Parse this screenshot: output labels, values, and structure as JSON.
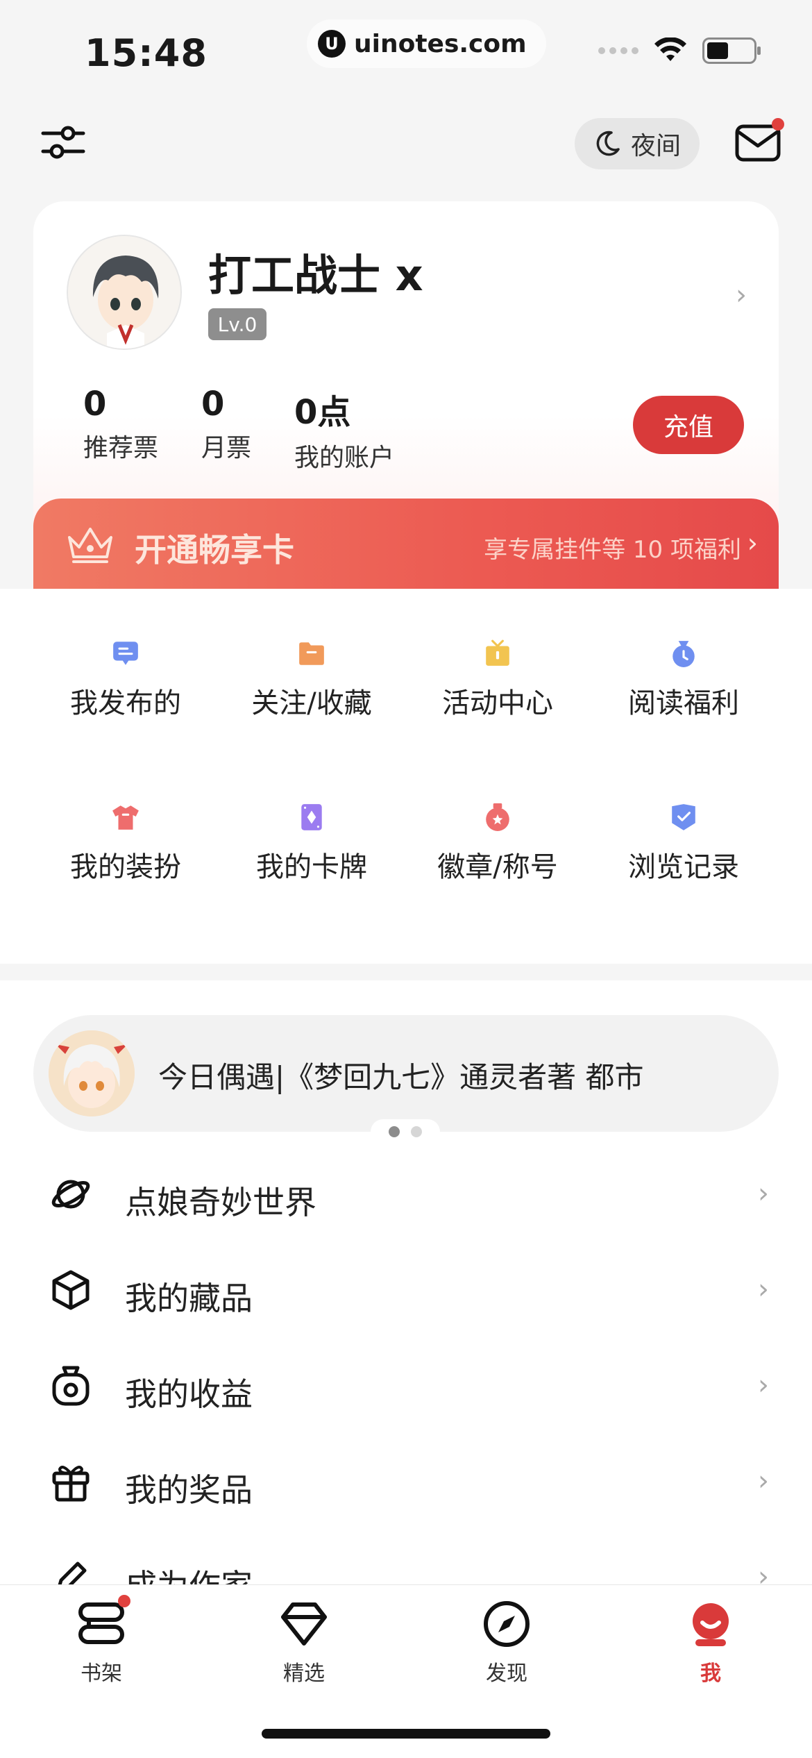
{
  "status_bar": {
    "time": "15:48",
    "url": "uinotes.com"
  },
  "header": {
    "night_label": "夜间"
  },
  "profile": {
    "username": "打工战士 x",
    "level": "Lv.0",
    "stats": [
      {
        "value": "0",
        "label": "推荐票"
      },
      {
        "value": "0",
        "label": "月票"
      },
      {
        "value": "0点",
        "label": "我的账户"
      }
    ],
    "recharge_label": "充值"
  },
  "vip": {
    "title": "开通畅享卡",
    "desc": "享专属挂件等 10 项福利"
  },
  "grid": [
    {
      "label": "我发布的",
      "icon": "chat-bubble-icon",
      "color": "#6f8ff0"
    },
    {
      "label": "关注/收藏",
      "icon": "folder-icon",
      "color": "#f19a5a"
    },
    {
      "label": "活动中心",
      "icon": "gift-icon",
      "color": "#f2c450"
    },
    {
      "label": "阅读福利",
      "icon": "money-bag-icon",
      "color": "#6f8ff0"
    },
    {
      "label": "我的装扮",
      "icon": "tshirt-icon",
      "color": "#ee6d6d"
    },
    {
      "label": "我的卡牌",
      "icon": "card-icon",
      "color": "#9b7cf0"
    },
    {
      "label": "徽章/称号",
      "icon": "medal-icon",
      "color": "#ee6d6d"
    },
    {
      "label": "浏览记录",
      "icon": "shield-check-icon",
      "color": "#6f8ff0"
    }
  ],
  "encounter": {
    "text": "今日偶遇|《梦回九七》通灵者著 都市"
  },
  "menu": [
    {
      "label": "点娘奇妙世界",
      "icon": "planet-icon"
    },
    {
      "label": "我的藏品",
      "icon": "cube-icon"
    },
    {
      "label": "我的收益",
      "icon": "coin-bag-icon"
    },
    {
      "label": "我的奖品",
      "icon": "gift-box-icon"
    },
    {
      "label": "成为作家",
      "icon": "pen-icon"
    }
  ],
  "tabs": [
    {
      "label": "书架",
      "icon": "bookshelf-icon"
    },
    {
      "label": "精选",
      "icon": "diamond-icon"
    },
    {
      "label": "发现",
      "icon": "compass-icon"
    },
    {
      "label": "我",
      "icon": "profile-icon"
    }
  ],
  "colors": {
    "accent": "#d93a3a",
    "dot": "#e0413e"
  }
}
